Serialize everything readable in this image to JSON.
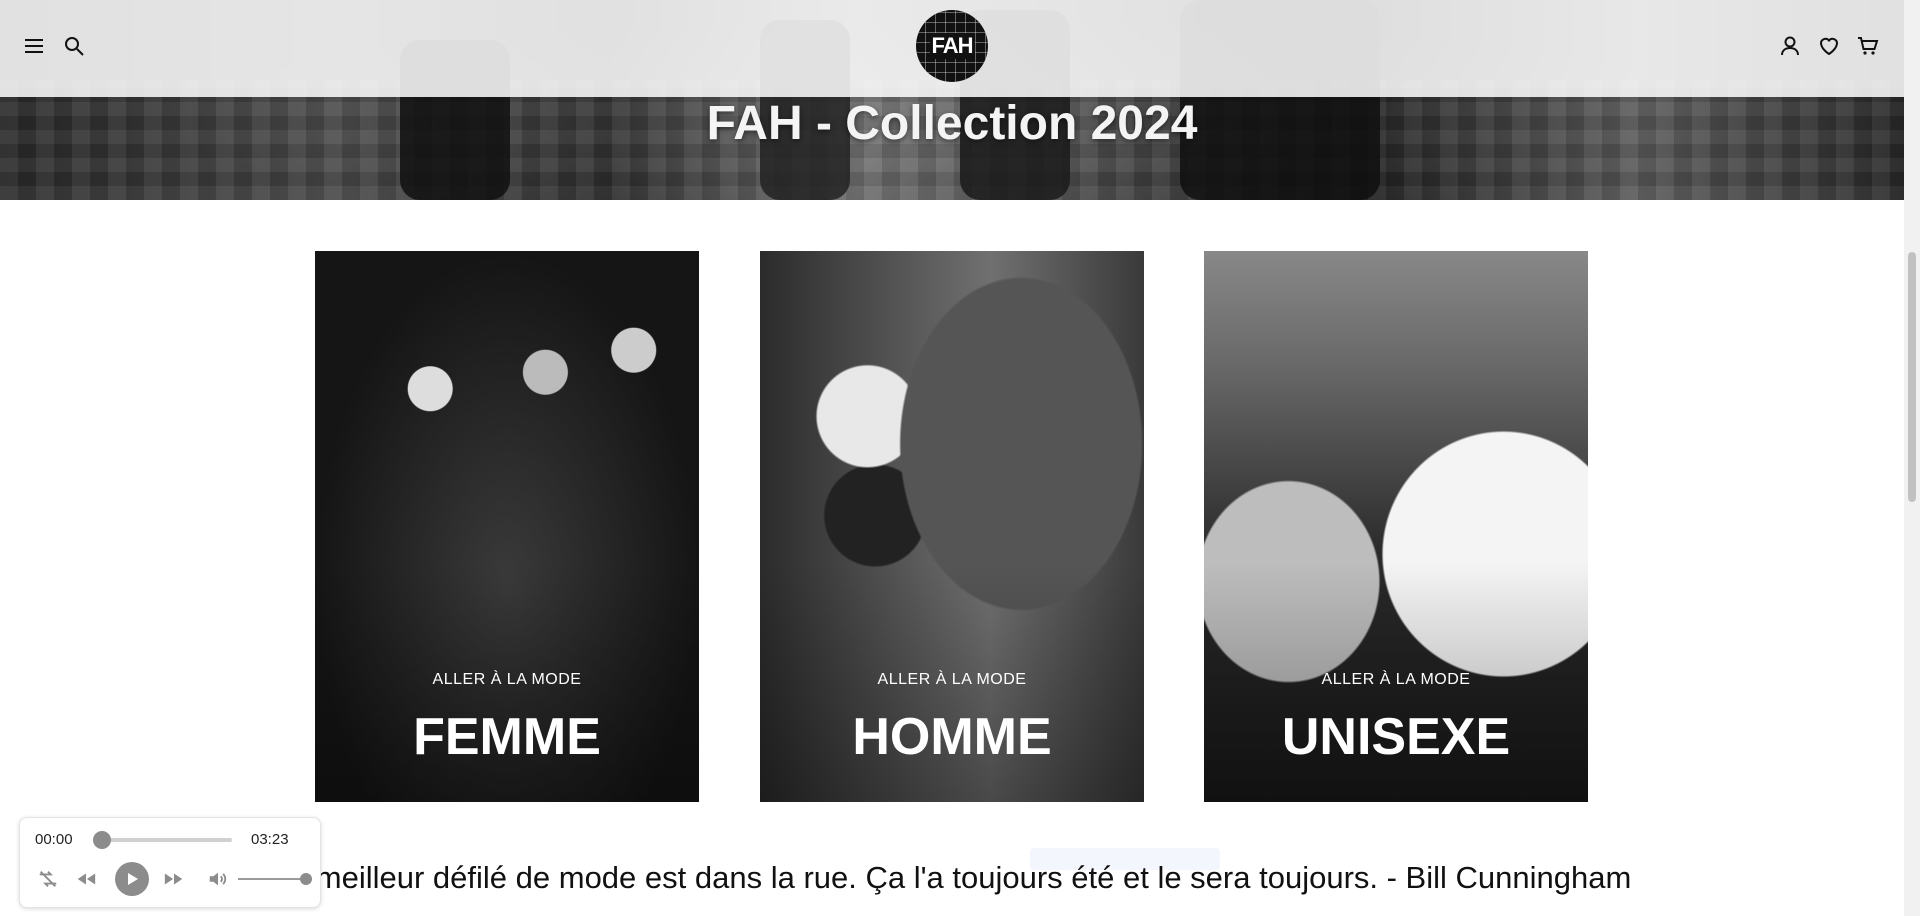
{
  "header": {
    "logo_text": "FAH",
    "icons": [
      "menu-icon",
      "search-icon",
      "account-icon",
      "wishlist-icon",
      "cart-icon"
    ]
  },
  "hero": {
    "title": "FAH - Collection 2024"
  },
  "cards": [
    {
      "kicker": "ALLER À LA MODE",
      "name": "FEMME"
    },
    {
      "kicker": "ALLER À LA MODE",
      "name": "HOMME"
    },
    {
      "kicker": "ALLER À LA MODE",
      "name": "UNISEXE"
    }
  ],
  "quote": "Le meilleur défilé de mode est dans la rue. Ça l'a toujours été et le sera toujours. - Bill Cunningham",
  "player": {
    "current_time": "00:00",
    "duration": "03:23",
    "progress": 0,
    "volume": 1.0
  },
  "colors": {
    "accent": "#111111",
    "player_control": "#8c8c8c"
  }
}
